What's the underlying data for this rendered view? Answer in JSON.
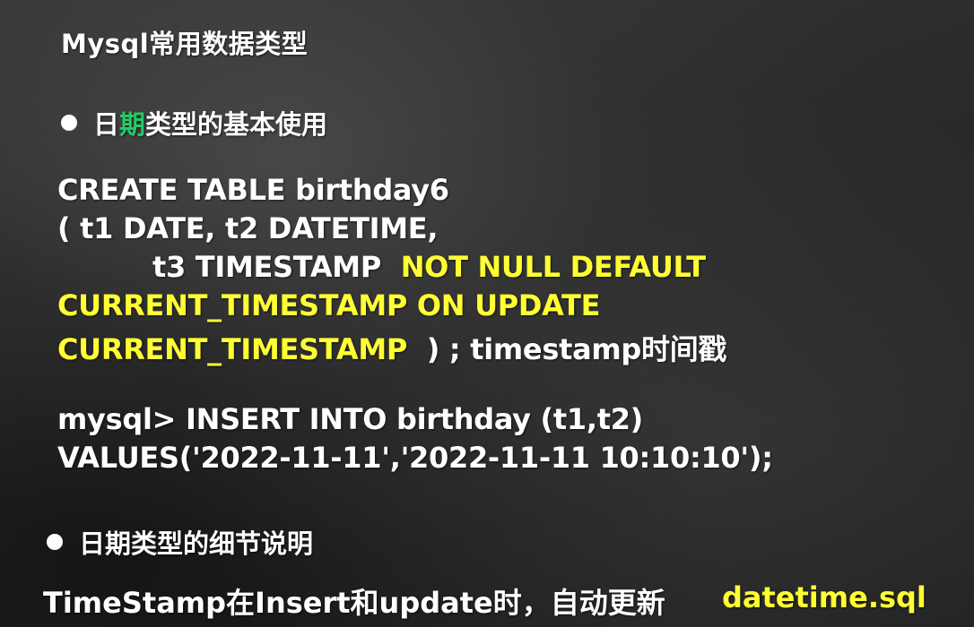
{
  "slide": {
    "title": "Mysql常用数据类型",
    "section1": {
      "part_a": "日",
      "part_b": "期",
      "part_c": "类型的基本使用"
    },
    "code": {
      "line1": "CREATE TABLE birthday6",
      "line2": "( t1 DATE, t2 DATETIME,",
      "line3_white": "t3 TIMESTAMP  ",
      "line3_yellow": "NOT NULL DEFAULT",
      "line4_yellow": "CURRENT_TIMESTAMP ON UPDATE",
      "line5_yellow": "CURRENT_TIMESTAMP  ",
      "line5_white": ") ; timestamp时间戳",
      "line6": "mysql> INSERT INTO birthday (t1,t2)",
      "line7": "VALUES('2022-11-11','2022-11-11 10:10:10');"
    },
    "section2": {
      "label": "日期类型的细节说明"
    },
    "footer": {
      "text": "TimeStamp在Insert和update时，自动更新",
      "file": "datetime.sql"
    }
  },
  "colors": {
    "highlight": "#ffff33",
    "accent": "#22cc66",
    "text": "#ffffff"
  }
}
